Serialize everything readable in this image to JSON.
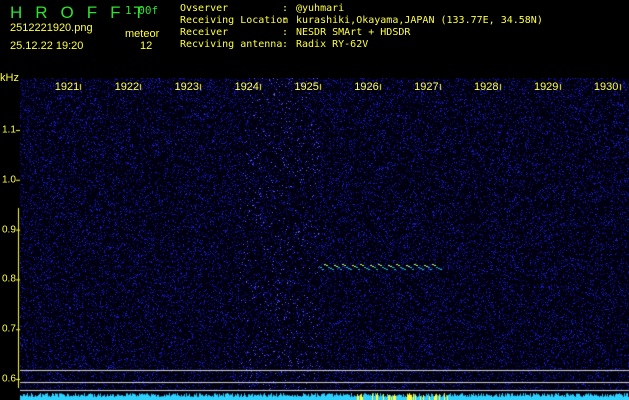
{
  "header": {
    "app_title": "HROFFT",
    "version": "1.00f",
    "filename": "2512221920.png",
    "datetime": "25.12.22 19:20",
    "meteor_label": "meteor",
    "meteor_count": "12"
  },
  "info": [
    {
      "label": "Ovserver",
      "value": "@yuhmari"
    },
    {
      "label": "Receiving Location",
      "value": "kurashiki,Okayama,JAPAN (133.77E, 34.58N)"
    },
    {
      "label": "Receiver",
      "value": "NESDR SMArt + HDSDR"
    },
    {
      "label": "Recviving antenna",
      "value": "Radix RY-62V"
    }
  ],
  "axis": {
    "y_unit": "kHz",
    "x_ticks": [
      "1921",
      "1922",
      "1923",
      "1924",
      "1925",
      "1926",
      "1927",
      "1928",
      "1929",
      "1930"
    ],
    "y_ticks": [
      "1.1",
      "1.0",
      "0.9",
      "0.8",
      "0.7",
      "0.6"
    ]
  },
  "colors": {
    "noise": "#1010c0",
    "signal": "#40ffa0",
    "axis": "#ffff40",
    "title": "#30e030"
  }
}
